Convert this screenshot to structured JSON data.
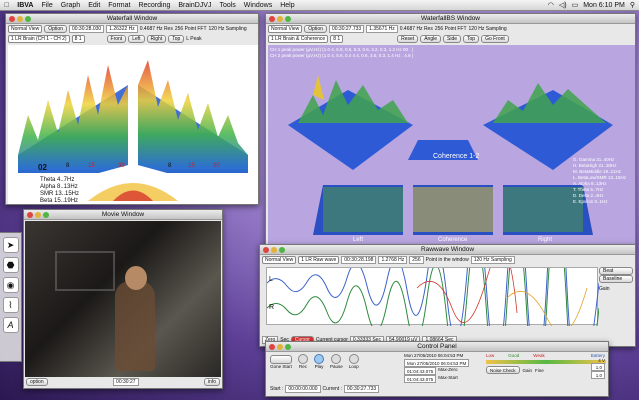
{
  "menubar": {
    "app": "IBVA",
    "items": [
      "File",
      "Graph",
      "Edit",
      "Format",
      "Recording",
      "BrainDJVJ",
      "Tools",
      "Windows",
      "Help"
    ],
    "clock": "Mon 6:10 PM",
    "apple_icon": "apple-icon"
  },
  "waterfall": {
    "title": "Waterfall Window",
    "view": "Normal View",
    "option": "Option",
    "time": "00:30:28.030",
    "freq": "1.26322 Hz",
    "res": "0.4687 Hz Res",
    "points": "256 Point FFT",
    "sampling_label": "120 Hz Sampling",
    "channel": "1 LR Brain (CH 1 - CH 2)",
    "nums": "8 1",
    "buttons": [
      "Front",
      "Left",
      "Right",
      "Top"
    ],
    "peak": "L Peak",
    "ticks": [
      "02",
      "8",
      "15",
      "30",
      "8",
      "15",
      "30"
    ],
    "bands": [
      "Theta 4..7Hz",
      "Alpha 8..13Hz",
      "SMR 13..15Hz",
      "Beta 15..19Hz"
    ]
  },
  "waterfall_bs": {
    "title": "WaterfallBS Window",
    "view": "Normal View",
    "option": "Option",
    "time": "00:30:27.733",
    "freq": "1.35671 Hz",
    "res": "0.4687 Hz Res",
    "points": "256 Point FFT",
    "sampling_label": "120 Hz Sampling",
    "channel": "1 LR Brain & Coherence",
    "nums": "8 1",
    "buttons": [
      "Reset",
      "Angle",
      "Side",
      "Top",
      "Go Front"
    ],
    "peak_text": "CH 1 peak power (µV,Hz) (1.0 4, 5.9, 0.6, 5.3, 0.6, 3.2, 0.3, 1.2 Hz 00 . )",
    "peak_text2": "CH 2 peak power (µV,Hz) (1.0 4, 5.6, 0.4 4.4, 0.6, 3.5, 0.3, 1.4 Hz . 4.9 )",
    "coherence": "Coherence 1-2",
    "legend": [
      "G. Gamma 31..40Hz",
      "H. BetaHigh 21..30Hz",
      "M. BetaMiddle 19..21Hz",
      "L. BetaLow/SMR 13..15Hz",
      "A. Alpha 8..13Hz",
      "T. Theta 5..7Hz",
      "D. Delta 2..4Hz",
      "E. Epsilon 0..1Hz"
    ],
    "axis": [
      "Left",
      "Coherence",
      "Right"
    ]
  },
  "movie": {
    "title": "Movie Window",
    "option": "option",
    "time": "00:30:27",
    "info": "info"
  },
  "rawwave": {
    "title": "Rawwave Window",
    "view": "Normal View",
    "channel": "1 LR Raw wave",
    "time": "00:30:28.198",
    "freq": "1.2768 Hz",
    "points": "256",
    "window_label": "Point in the window",
    "sampling_label": "120 Hz Sampling",
    "side": [
      "Beat",
      "Baseline",
      "Gain"
    ],
    "l": "L",
    "r": "R",
    "ctrl": [
      "Zero",
      "Sec",
      "Cursor",
      "Current cursor",
      "Center"
    ],
    "vals": [
      "0.33333 Sec",
      "54.90019 µV",
      "1.08664 Sec"
    ],
    "cursor_label": "Cursor"
  },
  "control": {
    "title": "Control Panel",
    "date": "Mon 27/05/2010 06:04:53 PM",
    "date2": "Mon 27/05/2010 06:04:53 PM",
    "buttons": [
      "Gone Start",
      "Rec",
      "Play",
      "Pause",
      "Loop"
    ],
    "zero": "Zero",
    "max": "Max",
    "start_label": "Start :",
    "start": "00:00:00.000",
    "current_label": "Current :",
    "current": "00:30:27.733",
    "total1": "01:04:43.075",
    "total2": "01:04:43.075",
    "max_zero": "Max-Zero",
    "max_start": "Max-Start",
    "battery": "Battery",
    "battery_val": "4 V",
    "noise": "Noise Check",
    "gain": "Gain",
    "fine": "Fine",
    "level": "1.0",
    "level2": "1.0",
    "markers": [
      "Low",
      "Good",
      "Weak"
    ],
    "bat2": "4V"
  },
  "colors": {
    "accent": "#3f5fd6",
    "wave_l": "#3b62c9",
    "wave_r": "#2e8a3e"
  }
}
